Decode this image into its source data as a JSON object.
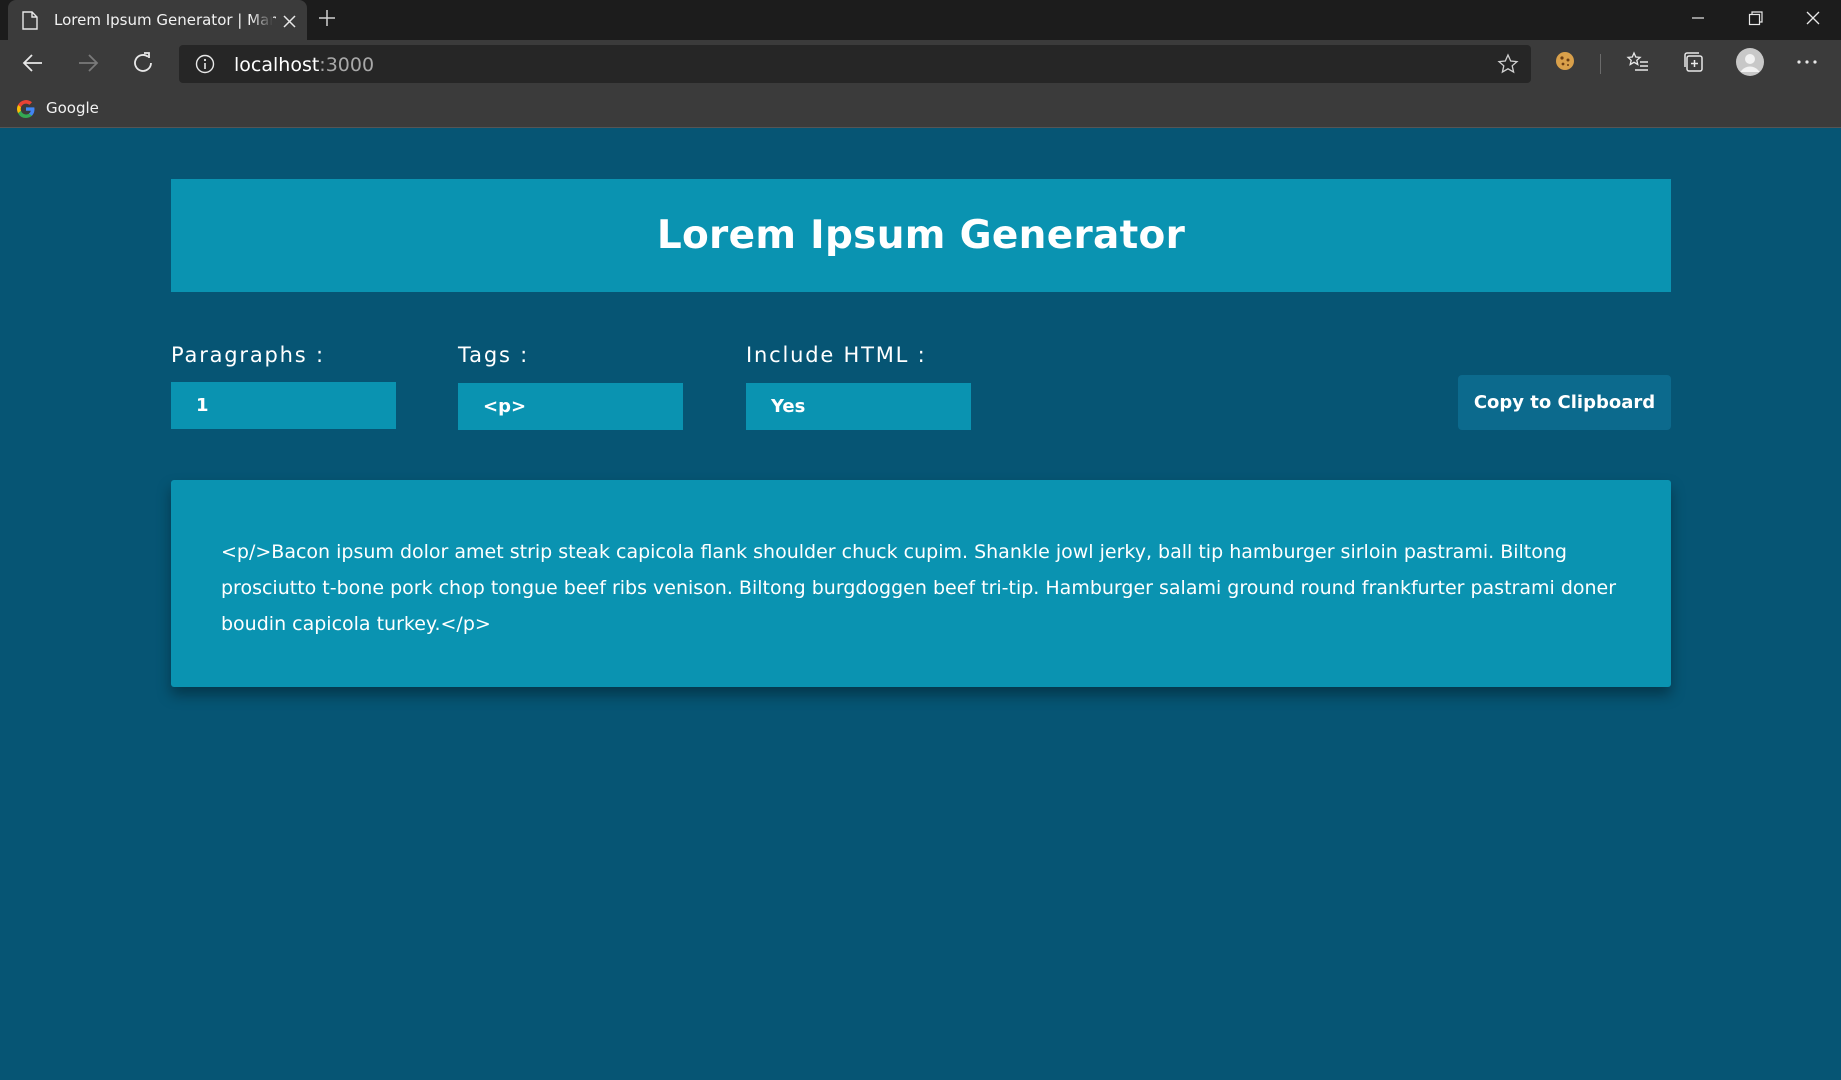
{
  "browser": {
    "tab_title": "Lorem Ipsum Generator | Manish",
    "url_host": "localhost",
    "url_port": ":3000",
    "bookmarks": [
      {
        "label": "Google",
        "icon": "google-icon"
      }
    ]
  },
  "header": {
    "title": "Lorem Ipsum Generator"
  },
  "controls": {
    "paragraphs": {
      "label": "Paragraphs :",
      "value": "1"
    },
    "tags": {
      "label": "Tags :",
      "value": "<p>"
    },
    "include_html": {
      "label": "Include HTML :",
      "value": "Yes"
    },
    "copy_button": "Copy to Clipboard"
  },
  "output": {
    "text": "<p/>Bacon ipsum dolor amet strip steak capicola flank shoulder chuck cupim. Shankle jowl jerky, ball tip hamburger sirloin pastrami. Biltong prosciutto t-bone pork chop tongue beef ribs venison. Biltong burgdoggen beef tri-tip. Hamburger salami ground round frankfurter pastrami doner boudin capicola turkey.</p>"
  },
  "colors": {
    "page_background": "#065574",
    "accent": "#0a93b1",
    "button": "#0c6a8d"
  }
}
